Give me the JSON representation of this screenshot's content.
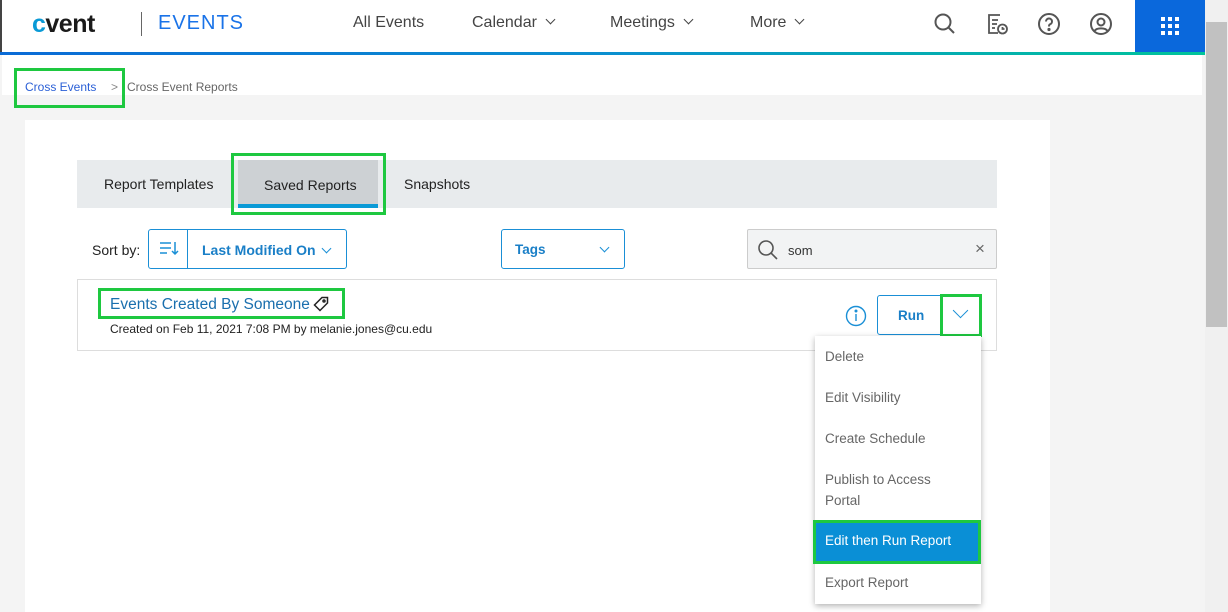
{
  "header": {
    "logo": "cvent",
    "app": "EVENTS",
    "nav": [
      "All Events",
      "Calendar",
      "Meetings",
      "More"
    ]
  },
  "icons": [
    "search-icon",
    "report-schedule-icon",
    "help-icon",
    "user-icon",
    "apps-grid-icon"
  ],
  "breadcrumb": {
    "parent": "Cross Events",
    "separator": ">",
    "current": "Cross Event Reports"
  },
  "tabs": [
    "Report Templates",
    "Saved Reports",
    "Snapshots"
  ],
  "toolbar": {
    "sort_label": "Sort by:",
    "sort_value": "Last Modified On",
    "tags": "Tags",
    "search_value": "som"
  },
  "report": {
    "title": "Events Created By Someone",
    "meta": "Created on Feb 11, 2021 7:08 PM by melanie.jones@cu.edu",
    "run": "Run"
  },
  "menu": [
    "Delete",
    "Edit Visibility",
    "Create Schedule",
    "Publish to Access Portal",
    "Edit then Run Report",
    "Export Report"
  ],
  "colors": {
    "brand": "#0a68dc",
    "accent": "#1a8fd6",
    "highlight": "#1ec840"
  }
}
